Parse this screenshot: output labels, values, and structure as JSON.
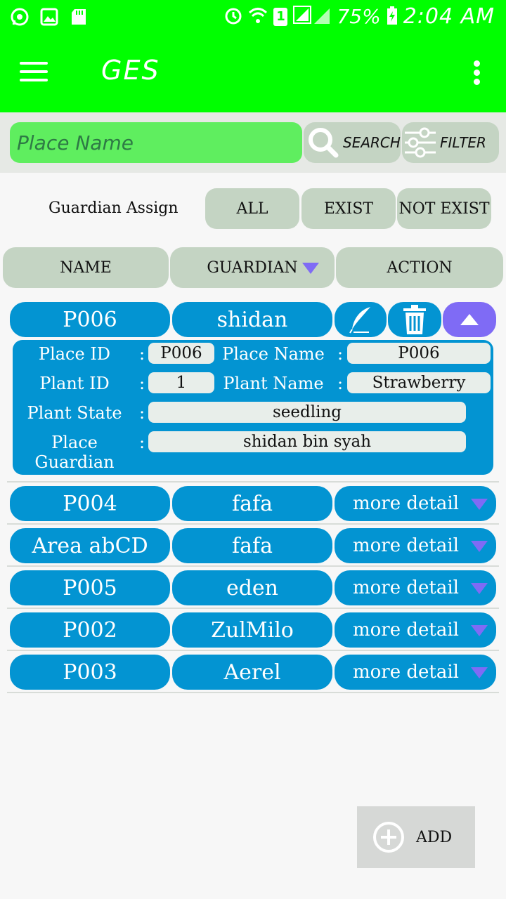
{
  "status_bar": {
    "battery": "75%",
    "time": "2:04 AM",
    "sim": "1"
  },
  "app_bar": {
    "title": "GES"
  },
  "search": {
    "placeholder": "Place Name",
    "search_label": "SEARCH",
    "filter_label": "FILTER"
  },
  "guardian_assign": {
    "label": "Guardian Assign",
    "options": [
      "ALL",
      "EXIST",
      "NOT EXIST"
    ]
  },
  "table_header": {
    "name": "NAME",
    "guardian": "GUARDIAN",
    "action": "ACTION"
  },
  "expanded_row": {
    "name": "P006",
    "guardian": "shidan",
    "details": {
      "place_id_label": "Place ID",
      "place_id": "P006",
      "place_name_label": "Place Name",
      "place_name": "P006",
      "plant_id_label": "Plant ID",
      "plant_id": "1",
      "plant_name_label": "Plant Name",
      "plant_name": "Strawberry",
      "plant_state_label": "Plant State",
      "plant_state": "seedling",
      "place_guardian_label_1": "Place",
      "place_guardian_label_2": "Guardian",
      "place_guardian": "shidan bin syah"
    }
  },
  "rows": [
    {
      "name": "P004",
      "guardian": "fafa",
      "action": "more detail"
    },
    {
      "name": "Area abCD",
      "guardian": "fafa",
      "action": "more detail"
    },
    {
      "name": "P005",
      "guardian": "eden",
      "action": "more detail"
    },
    {
      "name": "P002",
      "guardian": "ZulMilo",
      "action": "more detail"
    },
    {
      "name": "P003",
      "guardian": "Aerel",
      "action": "more detail"
    }
  ],
  "add_button": {
    "label": "ADD"
  },
  "colors": {
    "primary": "#00ff00",
    "row": "#0394d2",
    "accent": "#7f6bf5",
    "chip": "#c4d4c3"
  }
}
